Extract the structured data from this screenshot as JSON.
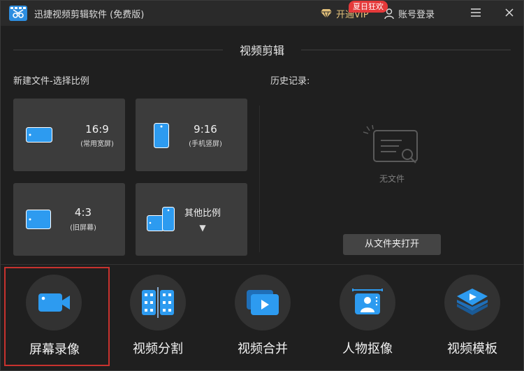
{
  "titlebar": {
    "app_title": "迅捷视频剪辑软件 (免费版)",
    "vip_label": "开通VIP",
    "vip_badge": "夏日狂欢",
    "account_label": "账号登录"
  },
  "section_title": "视频剪辑",
  "new_file": {
    "label": "新建文件-选择比例",
    "ratios": [
      {
        "main": "16:9",
        "sub": "(常用宽屏)"
      },
      {
        "main": "9:16",
        "sub": "(手机竖屏)"
      },
      {
        "main": "4:3",
        "sub": "(旧屏幕)"
      },
      {
        "main": "其他比例",
        "sub": "▼"
      }
    ]
  },
  "history": {
    "label": "历史记录:",
    "empty_text": "无文件",
    "open_folder_label": "从文件夹打开"
  },
  "tools": [
    {
      "label": "屏幕录像",
      "icon": "video-camera-icon",
      "selected": true
    },
    {
      "label": "视频分割",
      "icon": "film-split-icon",
      "selected": false
    },
    {
      "label": "视频合并",
      "icon": "video-merge-icon",
      "selected": false
    },
    {
      "label": "人物抠像",
      "icon": "portrait-cutout-icon",
      "selected": false
    },
    {
      "label": "视频模板",
      "icon": "template-layers-icon",
      "selected": false
    }
  ],
  "colors": {
    "accent_blue": "#2d9bf0",
    "vip_gold": "#e2c07a",
    "badge_red": "#e5393a",
    "selection_red": "#c8322e"
  }
}
